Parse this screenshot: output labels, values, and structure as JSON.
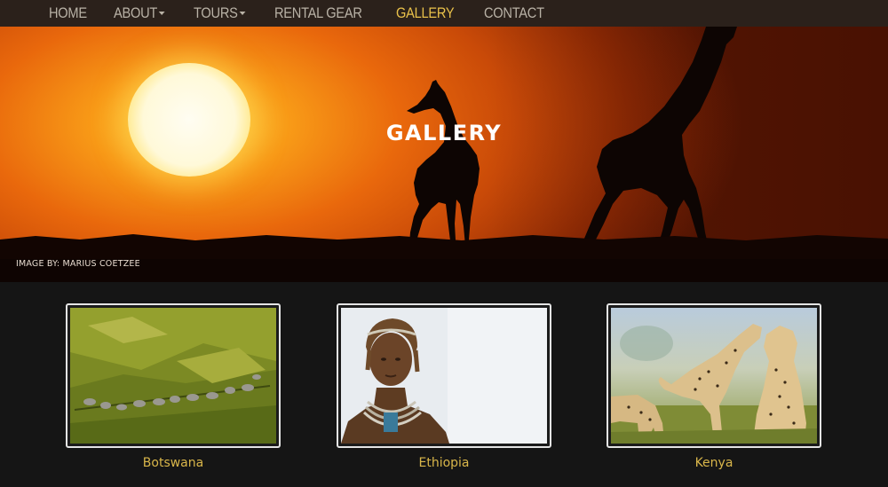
{
  "nav": {
    "items": [
      {
        "label": "HOME",
        "dropdown": false,
        "active": false
      },
      {
        "label": "ABOUT",
        "dropdown": true,
        "active": false
      },
      {
        "label": "TOURS",
        "dropdown": true,
        "active": false
      },
      {
        "label": "RENTAL GEAR",
        "dropdown": false,
        "active": false
      },
      {
        "label": "GALLERY",
        "dropdown": false,
        "active": true
      },
      {
        "label": "CONTACT",
        "dropdown": false,
        "active": false
      }
    ],
    "active_color": "#e9c14a",
    "text_color": "#b9b2a6"
  },
  "hero": {
    "title": "GALLERY",
    "credit": "IMAGE BY: MARIUS COETZEE"
  },
  "gallery": {
    "items": [
      {
        "label": "Botswana",
        "image": "elephant-herd-aerial"
      },
      {
        "label": "Ethiopia",
        "image": "portrait-woman"
      },
      {
        "label": "Kenya",
        "image": "cheetahs-playing"
      }
    ],
    "label_color": "#d9b64a"
  }
}
